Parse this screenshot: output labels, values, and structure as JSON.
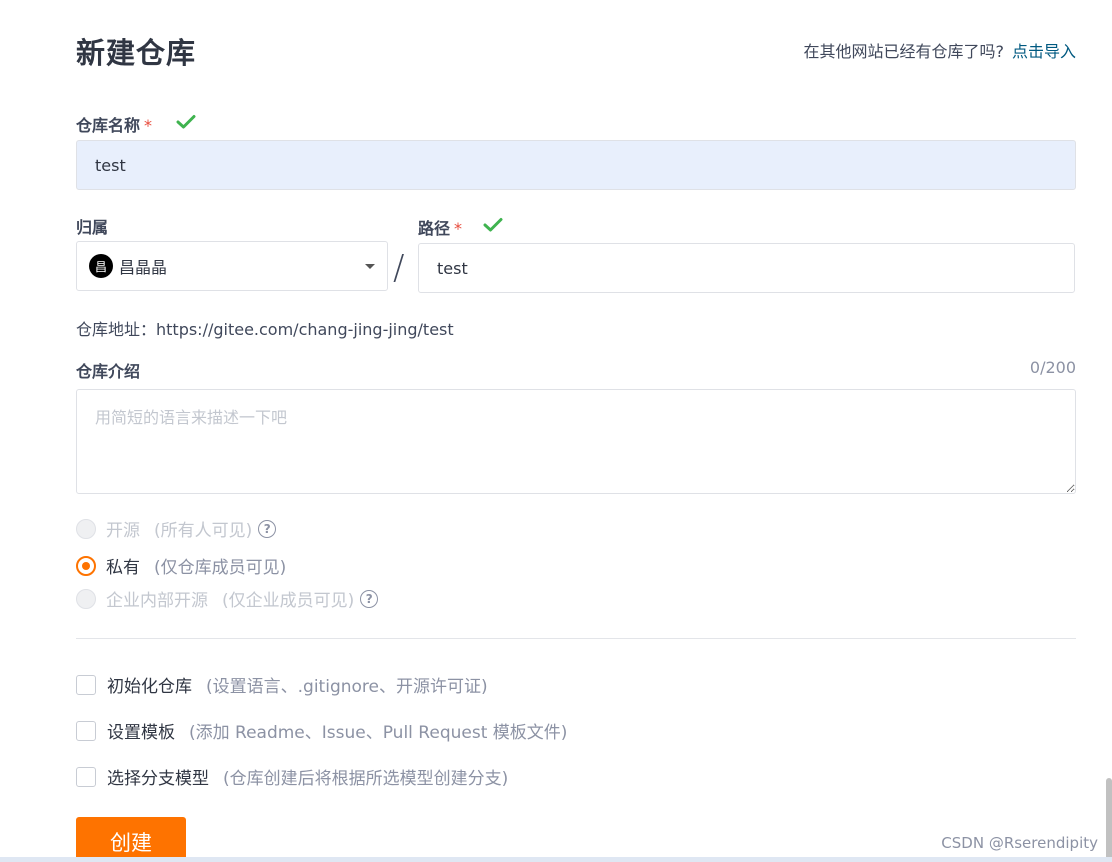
{
  "header": {
    "title": "新建仓库",
    "import_prompt": "在其他网站已经有仓库了吗?",
    "import_link": "点击导入"
  },
  "repo_name": {
    "label": "仓库名称",
    "required_mark": "*",
    "value": "test",
    "valid_icon": "check-icon"
  },
  "owner": {
    "label": "归属",
    "avatar_text": "昌",
    "value": "昌晶晶"
  },
  "separator": "/",
  "path": {
    "label": "路径",
    "required_mark": "*",
    "value": "test",
    "valid_icon": "check-icon"
  },
  "repo_url": "仓库地址：https://gitee.com/chang-jing-jing/test",
  "description": {
    "label": "仓库介绍",
    "counter": "0/200",
    "placeholder": "用简短的语言来描述一下吧"
  },
  "visibility": {
    "options": [
      {
        "label": "开源",
        "note": "(所有人可见)",
        "selected": false,
        "disabled": true,
        "help": "?"
      },
      {
        "label": "私有",
        "note": "(仅仓库成员可见)",
        "selected": true,
        "disabled": false
      },
      {
        "label": "企业内部开源",
        "note": "(仅企业成员可见)",
        "selected": false,
        "disabled": true,
        "help": "?"
      }
    ]
  },
  "options": [
    {
      "label": "初始化仓库",
      "note": "(设置语言、.gitignore、开源许可证)",
      "checked": false
    },
    {
      "label": "设置模板",
      "note": "(添加 Readme、Issue、Pull Request 模板文件)",
      "checked": false
    },
    {
      "label": "选择分支模型",
      "note": "(仓库创建后将根据所选模型创建分支)",
      "checked": false
    }
  ],
  "submit": {
    "label": "创建"
  },
  "watermark": "CSDN @Rserendipity",
  "colors": {
    "accent": "#fe7300",
    "link": "#005980",
    "valid": "#3fb34f",
    "required": "#e84b3c"
  }
}
